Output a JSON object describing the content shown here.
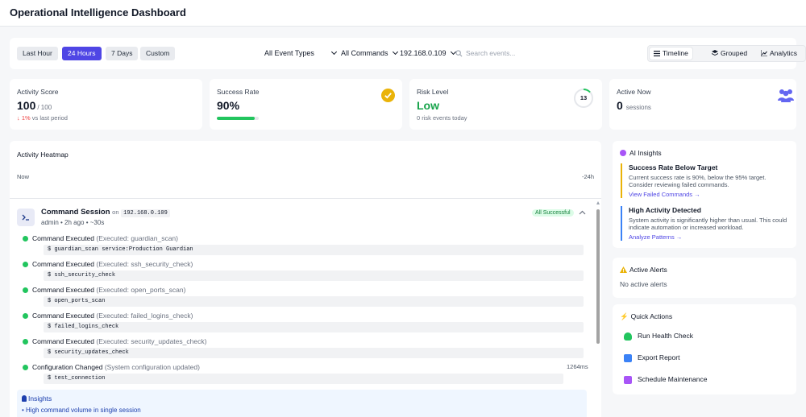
{
  "app": {
    "title": "Operational Intelligence Dashboard"
  },
  "filters": {
    "ranges": [
      "Last Hour",
      "24 Hours",
      "7 Days",
      "Custom"
    ],
    "active_range": "24 Hours",
    "event_type": "All Event Types",
    "commands": "All Commands",
    "host": "192.168.0.109",
    "search_placeholder": "Search events...",
    "views": [
      "Timeline",
      "Grouped",
      "Analytics"
    ],
    "active_view": "Timeline"
  },
  "stats": {
    "activity": {
      "label": "Activity Score",
      "value": "100",
      "unit": "/ 100",
      "change": "1%",
      "change_suffix": "vs last period"
    },
    "success": {
      "label": "Success Rate",
      "value": "90%",
      "progress": 0.9
    },
    "risk": {
      "label": "Risk Level",
      "value": "Low",
      "sub": "0 risk events today",
      "ring_value": "13"
    },
    "active": {
      "label": "Active Now",
      "value": "0",
      "unit": "sessions"
    }
  },
  "heatmap": {
    "title": "Activity Heatmap",
    "start_label": "Now",
    "end_label": "-24h"
  },
  "session": {
    "title": "Command Session",
    "on": "on",
    "host": "192.168.0.109",
    "meta": "admin • 2h ago • ~30s",
    "badge": "All Successful",
    "events": [
      {
        "title": "Command Executed",
        "detail": "(Executed: guardian_scan)",
        "code": "$ guardian_scan service:Production Guardian"
      },
      {
        "title": "Command Executed",
        "detail": "(Executed: ssh_security_check)",
        "code": "$ ssh_security_check"
      },
      {
        "title": "Command Executed",
        "detail": "(Executed: open_ports_scan)",
        "code": "$ open_ports_scan"
      },
      {
        "title": "Command Executed",
        "detail": "(Executed: failed_logins_check)",
        "code": "$ failed_logins_check"
      },
      {
        "title": "Command Executed",
        "detail": "(Executed: security_updates_check)",
        "code": "$ security_updates_check"
      },
      {
        "title": "Configuration Changed",
        "detail": "(System configuration updated)",
        "code": "$ test_connection",
        "duration": "1264ms"
      }
    ],
    "insights_title": "Insights",
    "insights_items": [
      "• High command volume in single session"
    ]
  },
  "ai_insights": {
    "title": "AI Insights",
    "items": [
      {
        "title": "Success Rate Below Target",
        "body": "Current success rate is 90%, below the 95% target. Consider reviewing failed commands.",
        "link": "View Failed Commands →",
        "color": "#eab308"
      },
      {
        "title": "High Activity Detected",
        "body": "System activity is significantly higher than usual. This could indicate automation or increased workload.",
        "link": "Analyze Patterns →",
        "color": "#3b82f6"
      }
    ]
  },
  "alerts": {
    "title": "Active Alerts",
    "empty": "No active alerts"
  },
  "quick_actions": {
    "title": "Quick Actions",
    "items": [
      {
        "label": "Run Health Check",
        "color": "#22c55e"
      },
      {
        "label": "Export Report",
        "color": "#3b82f6"
      },
      {
        "label": "Schedule Maintenance",
        "color": "#a855f7"
      }
    ]
  },
  "colors": {
    "accent": "#4f46e5",
    "success": "#22c55e",
    "warning": "#eab308",
    "danger": "#ef4444"
  }
}
